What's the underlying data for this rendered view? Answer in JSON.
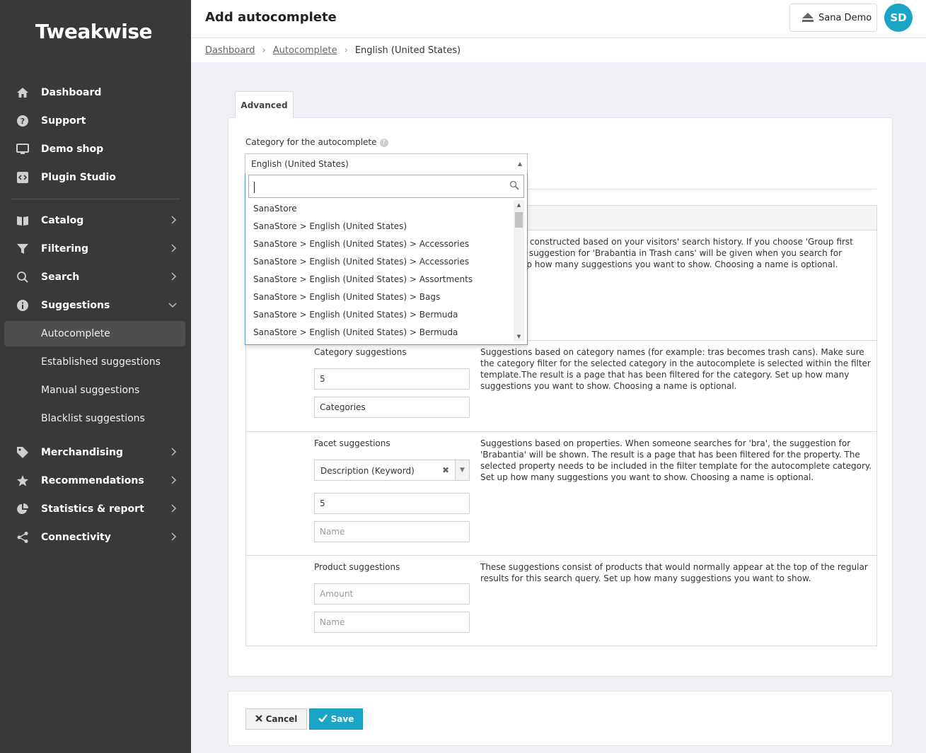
{
  "app": {
    "logo": "Tweakwise"
  },
  "sidebar": {
    "main_items": [
      {
        "label": "Dashboard",
        "icon": "home-icon"
      },
      {
        "label": "Support",
        "icon": "question-icon"
      },
      {
        "label": "Demo shop",
        "icon": "monitor-icon"
      },
      {
        "label": "Plugin Studio",
        "icon": "code-icon"
      }
    ],
    "section_items": [
      {
        "label": "Catalog",
        "icon": "book-icon"
      },
      {
        "label": "Filtering",
        "icon": "funnel-icon"
      },
      {
        "label": "Search",
        "icon": "search-icon"
      },
      {
        "label": "Suggestions",
        "icon": "info-icon"
      }
    ],
    "sub_items": [
      {
        "label": "Autocomplete",
        "active": true
      },
      {
        "label": "Established suggestions"
      },
      {
        "label": "Manual suggestions"
      },
      {
        "label": "Blacklist suggestions"
      }
    ],
    "lower_items": [
      {
        "label": "Merchandising",
        "icon": "tag-icon"
      },
      {
        "label": "Recommendations",
        "icon": "star-icon"
      },
      {
        "label": "Statistics & report",
        "icon": "pie-chart-icon"
      },
      {
        "label": "Connectivity",
        "icon": "share-icon"
      }
    ]
  },
  "header": {
    "title": "Add autocomplete",
    "account": "Sana Demo",
    "avatar_initials": "SD"
  },
  "breadcrumb": {
    "items": [
      "Dashboard",
      "Autocomplete",
      "English (United States)"
    ]
  },
  "tabs": {
    "advanced": "Advanced"
  },
  "category_field": {
    "label": "Category for the autocomplete",
    "value": "English (United States)",
    "search_value": "",
    "options": [
      "SanaStore",
      "SanaStore > English (United States)",
      "SanaStore > English (United States) > Accessories",
      "SanaStore > English (United States) > Accessories",
      "SanaStore > English (United States) > Assortments",
      "SanaStore > English (United States) > Bags",
      "SanaStore > English (United States) > Bermuda",
      "SanaStore > English (United States) > Bermuda"
    ]
  },
  "rows": {
    "search_history": {
      "desc_line1": "estions are constructed based on your visitors' search history. If you choose 'Group first",
      "desc_line2": "egory', the suggestion for 'Brabantia in Trash cans' will be given when you search for",
      "desc_line3": "Next, set up how many suggestions you want to show. Choosing a name is optional."
    },
    "category": {
      "title": "Category suggestions",
      "desc": "Suggestions based on category names (for example: tras becomes trash cans). Make sure the category filter for the selected category in the autocomplete is selected within the filter template.The result is a page that has been filtered for the category. Set up how many suggestions you want to show. Choosing a name is optional.",
      "amount": "5",
      "name": "Categories"
    },
    "facet": {
      "title": "Facet suggestions",
      "desc": "Suggestions based on properties. When someone searches for 'bra', the suggestion for 'Brabantia' will be shown. The result is a page that has been filtered for the property. The selected property needs to be included in the filter template for the autocomplete category. Set up how many suggestions you want to show. Choosing a name is optional.",
      "property": "Description (Keyword)",
      "amount": "5",
      "name_placeholder": "Name"
    },
    "product": {
      "title": "Product suggestions",
      "desc": "These suggestions consist of products that would normally appear at the top of the regular results for this search query. Set up how many suggestions you want to show.",
      "amount_placeholder": "Amount",
      "name_placeholder": "Name"
    }
  },
  "actions": {
    "cancel": "Cancel",
    "save": "Save"
  },
  "colors": {
    "sidebar_bg": "#393939",
    "accent": "#1aa5c7",
    "page_bg": "#eef0f5"
  }
}
